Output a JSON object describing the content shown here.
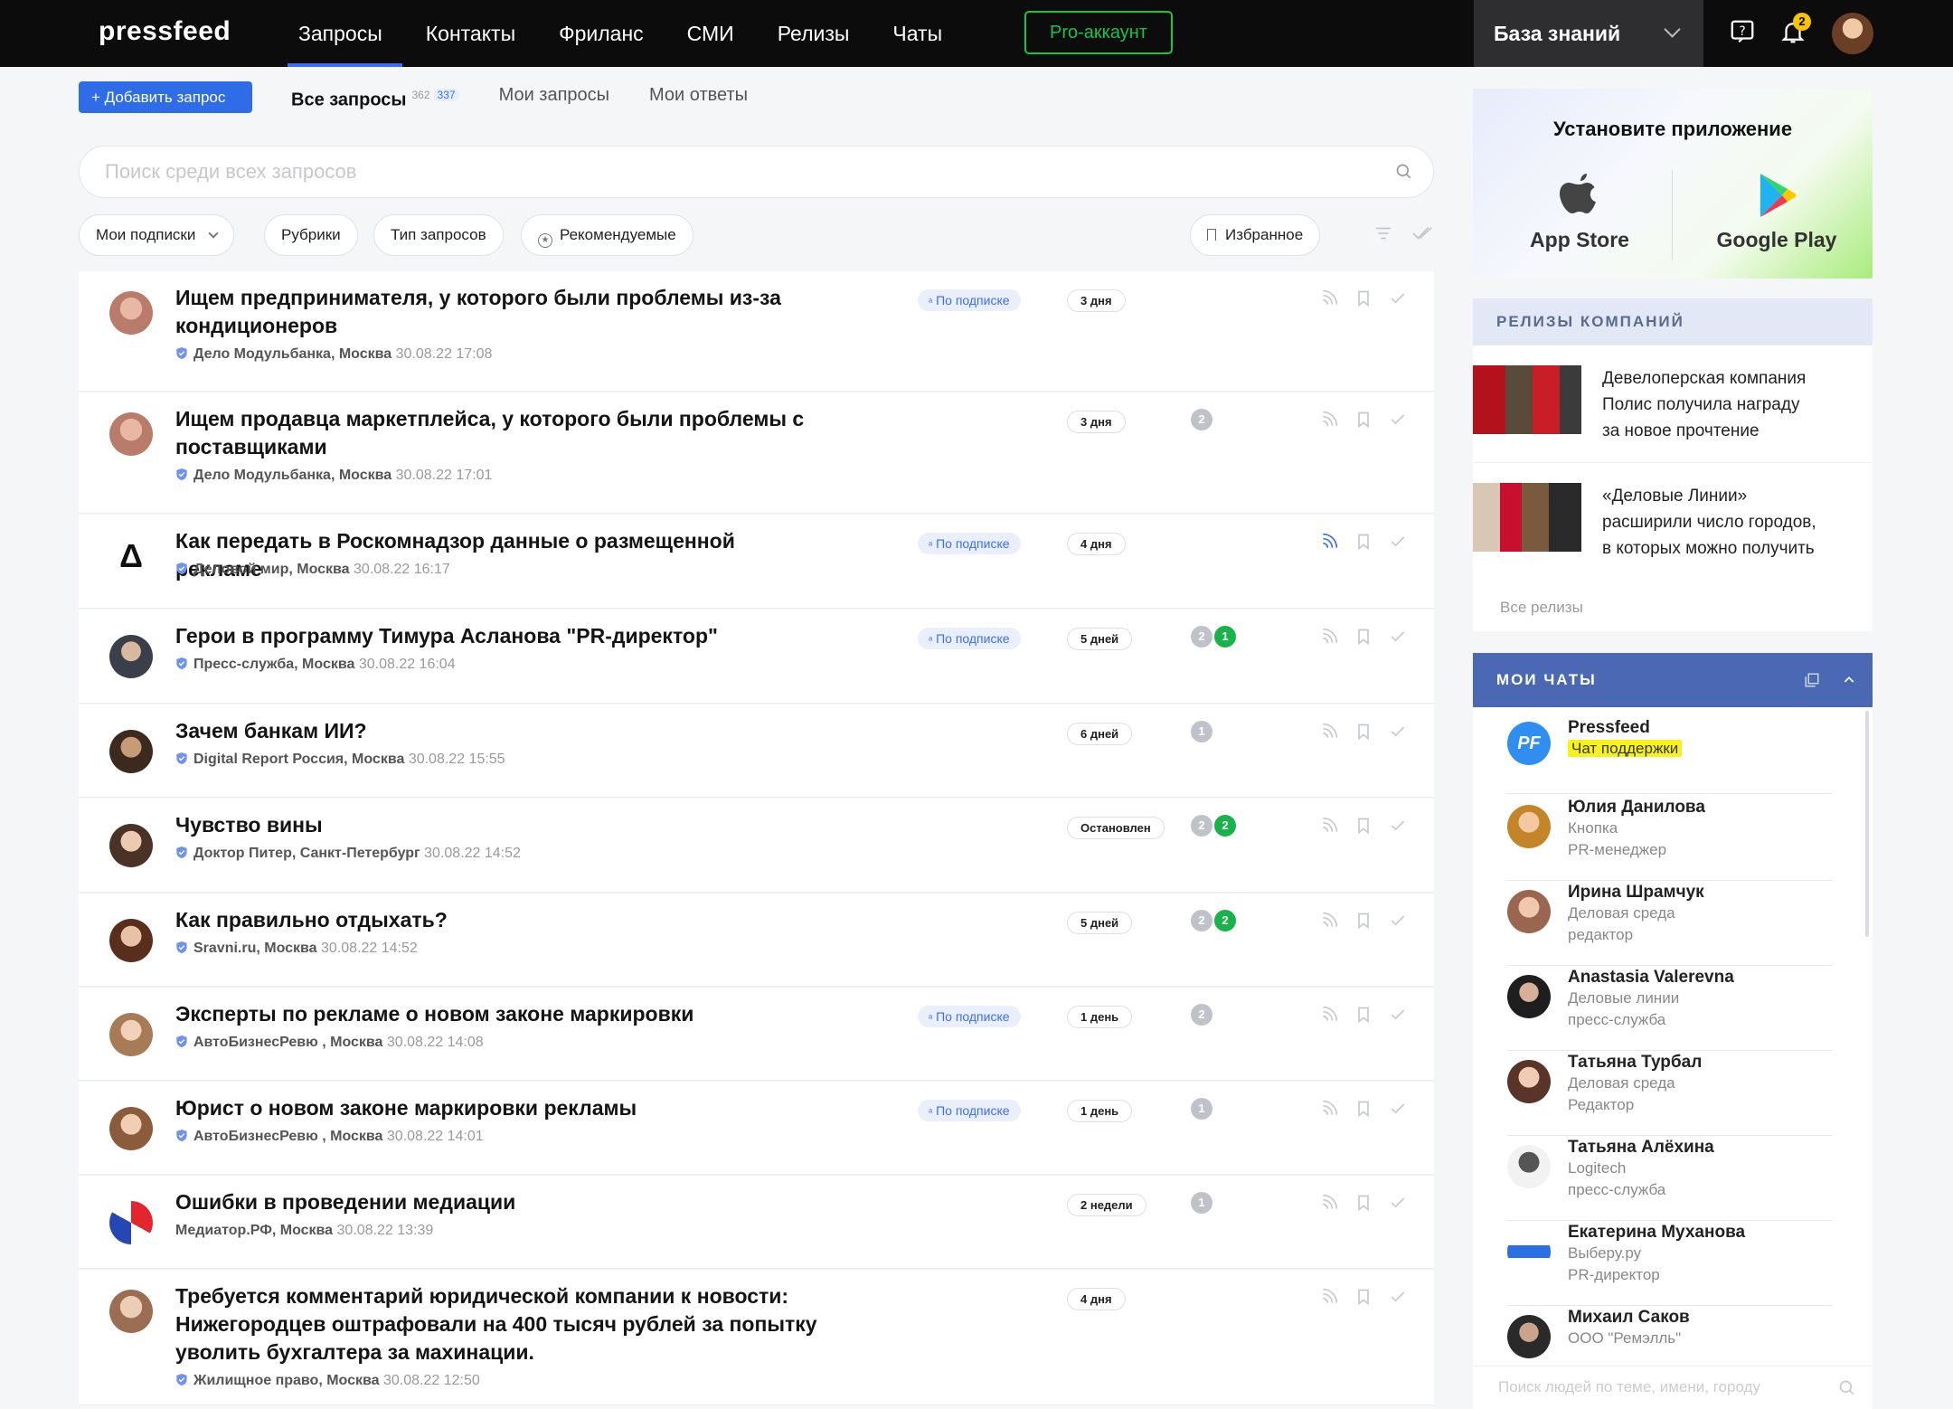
{
  "header": {
    "logo": "pressfeed",
    "nav": [
      "Запросы",
      "Контакты",
      "Фриланс",
      "СМИ",
      "Релизы",
      "Чаты"
    ],
    "pro": "Pro-аккаунт",
    "kb": "База знаний",
    "notif_count": "2"
  },
  "toolbar": {
    "add": "+ Добавить запрос",
    "tabs": {
      "all": "Все запросы",
      "all_c1": "362",
      "all_c2": "337",
      "mine": "Мои запросы",
      "answers": "Мои ответы"
    },
    "search_placeholder": "Поиск среди всех запросов"
  },
  "filters": {
    "subs": "Мои подписки",
    "rubrics": "Рубрики",
    "types": "Тип запросов",
    "recommended": "Рекомендуемые",
    "favorites": "Избранное"
  },
  "rows": [
    {
      "title1": "Ищем предпринимателя, у которого были проблемы из-за",
      "title2": "кондиционеров",
      "title3": "",
      "org": "Дело Модульбанка, Москва",
      "date": "30.08.22 17:08",
      "sub": "По подписке",
      "days": "3 дня",
      "c1": "",
      "c2": ""
    },
    {
      "title1": "Ищем продавца маркетплейса, у которого были проблемы с",
      "title2": "поставщиками",
      "title3": "",
      "org": "Дело Модульбанка, Москва",
      "date": "30.08.22 17:01",
      "sub": "",
      "days": "3 дня",
      "c1": "2",
      "c2": ""
    },
    {
      "title1": "Как передать в Роскомнадзор данные о размещенной рекламе",
      "title2": "",
      "title3": "",
      "org": "Деловой мир, Москва",
      "date": "30.08.22 16:17",
      "sub": "По подписке",
      "days": "4 дня",
      "c1": "",
      "c2": ""
    },
    {
      "title1": "Герои в программу Тимура Асланова \"PR-директор\"",
      "title2": "",
      "title3": "",
      "org": "Пресс-служба, Москва",
      "date": "30.08.22 16:04",
      "sub": "По подписке",
      "days": "5 дней",
      "c1": "2",
      "c2": "1"
    },
    {
      "title1": "Зачем банкам ИИ?",
      "title2": "",
      "title3": "",
      "org": "Digital Report Россия, Москва",
      "date": "30.08.22 15:55",
      "sub": "",
      "days": "6 дней",
      "c1": "1",
      "c2": ""
    },
    {
      "title1": "Чувство вины",
      "title2": "",
      "title3": "",
      "org": "Доктор Питер, Санкт-Петербург",
      "date": "30.08.22 14:52",
      "sub": "",
      "days": "Остановлен",
      "c1": "2",
      "c2": "2"
    },
    {
      "title1": "Как правильно отдыхать?",
      "title2": "",
      "title3": "",
      "org": "Sravni.ru, Москва",
      "date": "30.08.22 14:52",
      "sub": "",
      "days": "5 дней",
      "c1": "2",
      "c2": "2"
    },
    {
      "title1": "Эксперты по рекламе о новом законе маркировки",
      "title2": "",
      "title3": "",
      "org": "АвтоБизнесРевю , Москва",
      "date": "30.08.22 14:08",
      "sub": "По подписке",
      "days": "1 день",
      "c1": "2",
      "c2": ""
    },
    {
      "title1": "Юрист о новом законе маркировки рекламы",
      "title2": "",
      "title3": "",
      "org": "АвтоБизнесРевю , Москва",
      "date": "30.08.22 14:01",
      "sub": "По подписке",
      "days": "1 день",
      "c1": "1",
      "c2": ""
    },
    {
      "title1": "Ошибки в проведении медиации",
      "title2": "",
      "title3": "",
      "org": "Медиатор.РФ, Москва",
      "date": "30.08.22 13:39",
      "sub": "",
      "days": "2 недели",
      "c1": "1",
      "c2": ""
    },
    {
      "title1": "Требуется комментарий юридической компании к новости:",
      "title2": "Нижегородцев оштрафовали на 400 тысяч рублей за попытку",
      "title3": "уволить бухгалтера за махинации.",
      "org": "Жилищное право, Москва",
      "date": "30.08.22 12:50",
      "sub": "",
      "days": "4 дня",
      "c1": "",
      "c2": ""
    }
  ],
  "app": {
    "title": "Установите приложение",
    "appstore": "App Store",
    "googleplay": "Google Play"
  },
  "releases": {
    "head": "РЕЛИЗЫ КОМПАНИЙ",
    "items": [
      {
        "l1": "Девелоперская компания",
        "l2": "Полис получила награду",
        "l3": "за новое прочтение"
      },
      {
        "l1": "«Деловые Линии»",
        "l2": "расширили число городов,",
        "l3": "в которых можно получить"
      }
    ],
    "all": "Все релизы"
  },
  "chats": {
    "head": "МОИ ЧАТЫ",
    "items": [
      {
        "name": "Pressfeed",
        "l2": "Чат поддержки",
        "l3": ""
      },
      {
        "name": "Юлия Данилова",
        "l2": "Кнопка",
        "l3": "PR-менеджер"
      },
      {
        "name": "Ирина Шрамчук",
        "l2": "Деловая среда",
        "l3": "редактор"
      },
      {
        "name": "Anastasia Valerevna",
        "l2": "Деловые линии",
        "l3": "пресс-служба"
      },
      {
        "name": "Татьяна Турбал",
        "l2": "Деловая среда",
        "l3": "Редактор"
      },
      {
        "name": "Татьяна Алёхина",
        "l2": "Logitech",
        "l3": "пресс-служба"
      },
      {
        "name": "Екатерина Муханова",
        "l2": "Выберу.ру",
        "l3": "PR-директор"
      },
      {
        "name": "Михаил Саков",
        "l2": "ООО \"Ремэлль\"",
        "l3": ""
      }
    ],
    "search_placeholder": "Поиск людей по теме, имени, городу"
  },
  "colors": {
    "accent": "#2f6de8",
    "pro": "#19c34a",
    "chats_head": "#4a68b3",
    "count_green": "#1ab24a"
  }
}
